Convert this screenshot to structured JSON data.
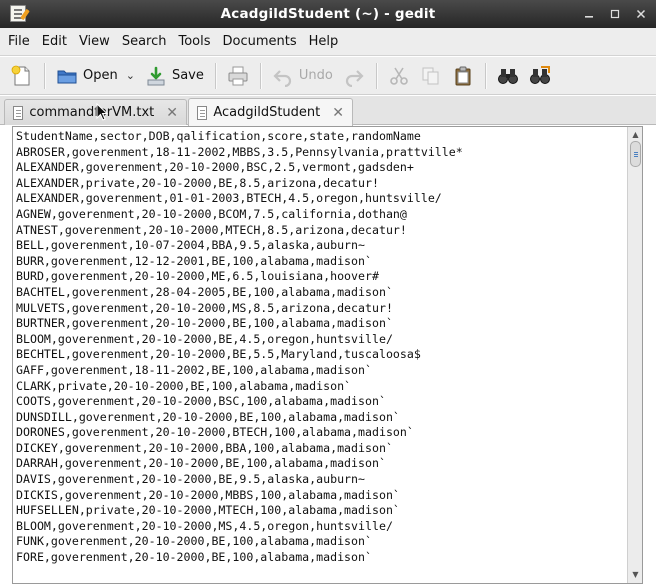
{
  "window": {
    "title": "AcadgildStudent (~) - gedit"
  },
  "menu": [
    "File",
    "Edit",
    "View",
    "Search",
    "Tools",
    "Documents",
    "Help"
  ],
  "toolbar": {
    "open_label": "Open",
    "save_label": "Save",
    "undo_label": "Undo"
  },
  "tabs": [
    {
      "label": "commandforVM.txt",
      "active": false
    },
    {
      "label": "AcadgildStudent",
      "active": true
    }
  ],
  "document": {
    "lines": [
      "StudentName,sector,DOB,qalification,score,state,randomName",
      "ABROSER,goverenment,18-11-2002,MBBS,3.5,Pennsylvania,prattville*",
      "ALEXANDER,goverenment,20-10-2000,BSC,2.5,vermont,gadsden+",
      "ALEXANDER,private,20-10-2000,BE,8.5,arizona,decatur!",
      "ALEXANDER,goverenment,01-01-2003,BTECH,4.5,oregon,huntsville/",
      "AGNEW,goverenment,20-10-2000,BCOM,7.5,california,dothan@",
      "ATNEST,goverenment,20-10-2000,MTECH,8.5,arizona,decatur!",
      "BELL,goverenment,10-07-2004,BBA,9.5,alaska,auburn~",
      "BURR,goverenment,12-12-2001,BE,100,alabama,madison`",
      "BURD,goverenment,20-10-2000,ME,6.5,louisiana,hoover#",
      "BACHTEL,goverenment,28-04-2005,BE,100,alabama,madison`",
      "MULVETS,goverenment,20-10-2000,MS,8.5,arizona,decatur!",
      "BURTNER,goverenment,20-10-2000,BE,100,alabama,madison`",
      "BLOOM,goverenment,20-10-2000,BE,4.5,oregon,huntsville/",
      "BECHTEL,goverenment,20-10-2000,BE,5.5,Maryland,tuscaloosa$",
      "GAFF,goverenment,18-11-2002,BE,100,alabama,madison`",
      "CLARK,private,20-10-2000,BE,100,alabama,madison`",
      "COOTS,goverenment,20-10-2000,BSC,100,alabama,madison`",
      "DUNSDILL,goverenment,20-10-2000,BE,100,alabama,madison`",
      "DORONES,goverenment,20-10-2000,BTECH,100,alabama,madison`",
      "DICKEY,goverenment,20-10-2000,BBA,100,alabama,madison`",
      "DARRAH,goverenment,20-10-2000,BE,100,alabama,madison`",
      "DAVIS,goverenment,20-10-2000,BE,9.5,alaska,auburn~",
      "DICKIS,goverenment,20-10-2000,MBBS,100,alabama,madison`",
      "HUFSELLEN,private,20-10-2000,MTECH,100,alabama,madison`",
      "BLOOM,goverenment,20-10-2000,MS,4.5,oregon,huntsville/",
      "FUNK,goverenment,20-10-2000,BE,100,alabama,madison`",
      "FORE,goverenment,20-10-2000,BE,100,alabama,madison`"
    ]
  },
  "icons": {
    "new": "new-document-icon",
    "open": "folder-open-icon",
    "save": "save-icon",
    "print": "printer-icon",
    "undo": "undo-icon",
    "redo": "redo-icon",
    "cut": "scissors-icon",
    "copy": "copy-icon",
    "paste": "clipboard-icon",
    "find": "binoculars-icon",
    "replace": "find-replace-icon"
  },
  "colors": {
    "titlebar": "#2f2f2f",
    "chrome": "#ededed",
    "accent": "#4a7fc0"
  }
}
